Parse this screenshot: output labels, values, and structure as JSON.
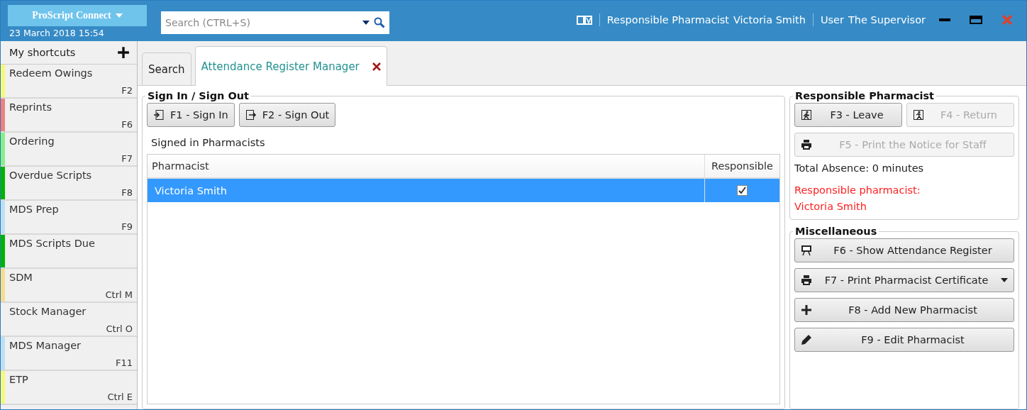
{
  "header": {
    "app_name": "ProScript Connect",
    "datetime": "23 March 2018 15:54",
    "search": {
      "placeholder": "Search (CTRL+S)"
    },
    "pharmacist_label": "Responsible Pharmacist",
    "pharmacist_name": "Victoria Smith",
    "user_label": "User",
    "user_name": "The Supervisor"
  },
  "sidebar": {
    "title": "My shortcuts",
    "items": [
      {
        "label": "Redeem Owings",
        "shortcut": "F2",
        "color": "#f7f77a"
      },
      {
        "label": "Reprints",
        "shortcut": "F6",
        "color": "#f08080"
      },
      {
        "label": "Ordering",
        "shortcut": "F7",
        "color": "#86f086"
      },
      {
        "label": "Overdue Scripts",
        "shortcut": "F8",
        "color": "#00b400"
      },
      {
        "label": "MDS Prep",
        "shortcut": "F9",
        "color": "#bcdff5"
      },
      {
        "label": "MDS Scripts Due",
        "color": "#00b400"
      },
      {
        "label": "SDM",
        "shortcut": "Ctrl M",
        "color": "#f7dc8c"
      },
      {
        "label": "Stock Manager",
        "shortcut": "Ctrl O"
      },
      {
        "label": "MDS Manager",
        "shortcut": "F11",
        "color": "#bcdff5"
      },
      {
        "label": "ETP",
        "shortcut": "Ctrl E",
        "color": "#f7f77a"
      }
    ]
  },
  "tabs": [
    {
      "label": "Search",
      "selected": false,
      "closable": false
    },
    {
      "label": "Attendance Register Manager",
      "selected": true,
      "closable": true
    }
  ],
  "sign_in": {
    "title": "Sign In / Sign Out",
    "buttons": [
      {
        "label": "F1 - Sign In",
        "disabled": false
      },
      {
        "label": "F2 - Sign Out",
        "disabled": false
      }
    ],
    "list_title": "Signed in Pharmacists",
    "table": {
      "columns": [
        "Pharmacist",
        "Responsible"
      ],
      "rows": [
        {
          "pharmacist": "Victoria Smith",
          "responsible": true,
          "selected": true
        }
      ]
    }
  },
  "responsible": {
    "title": "Responsible Pharmacist",
    "buttons": [
      {
        "label": "F3 - Leave",
        "disabled": false
      },
      {
        "label": "F4 - Return",
        "disabled": true
      },
      {
        "label": "F5 - Print the Notice for Staff",
        "disabled": true
      }
    ],
    "absence": "Total Absence: 0 minutes",
    "status_label": "Responsible pharmacist:",
    "status_name": "Victoria Smith"
  },
  "misc": {
    "title": "Miscellaneous",
    "buttons": [
      {
        "label": "F6 - Show Attendance Register",
        "disabled": false,
        "dropdown": false
      },
      {
        "label": "F7 - Print Pharmacist Certificate",
        "disabled": false,
        "dropdown": true
      },
      {
        "label": "F8 - Add New Pharmacist",
        "disabled": false,
        "dropdown": false
      },
      {
        "label": "F9 - Edit Pharmacist",
        "disabled": false,
        "dropdown": false
      }
    ]
  }
}
